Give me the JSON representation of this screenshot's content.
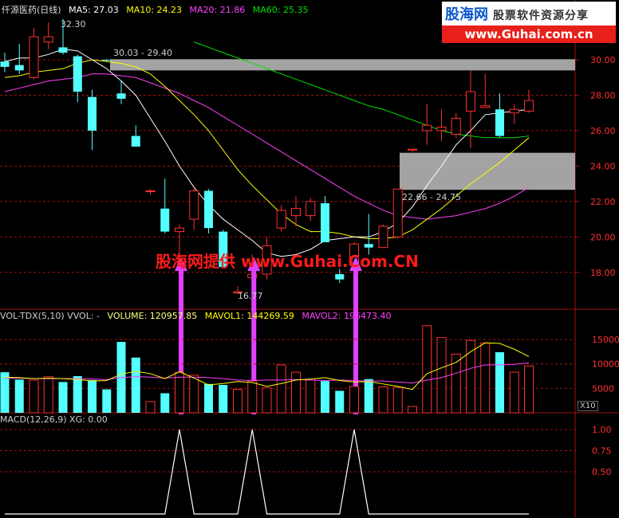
{
  "header": {
    "stock": "仟源医药(日线)",
    "ma5": "MA5: 27.03",
    "ma10": "MA10: 24.23",
    "ma20": "MA20: 21.86",
    "ma60": "MA60: 25.35"
  },
  "logo": {
    "line1": "股海网",
    "line1b": "股票软件资源分享",
    "line2": "www.Guhai.com.cn"
  },
  "watermark": "股海网提供 www.Guhai.Com.CN",
  "annotations": {
    "high_label": "32.30",
    "band_top": "30.03 - 29.40",
    "band_bottom": "22.66 - 24.75",
    "low_label": "16.77"
  },
  "volume_header": {
    "prefix": "VOL-TDX(5,10)  VVOL: -",
    "volume": "VOLUME: 120957.85",
    "mavol1": "MAVOL1: 144269.59",
    "mavol2": "MAVOL2: 196473.40"
  },
  "macd_header": "MACD(12,26,9)  XG: 0.00",
  "volume_unit": "X10",
  "colors": {
    "up": "#ff3030",
    "down": "#54ffff",
    "ma5": "#ffffff",
    "ma10": "#ffff00",
    "ma20": "#ff40ff",
    "ma60": "#00e000",
    "arrow": "#e040ff",
    "band": "#c0c0c0",
    "grid": "#a01010"
  },
  "chart_data": [
    {
      "type": "candlestick",
      "title": "仟源医药(日线)",
      "y_ticks": [
        18.0,
        20.0,
        22.0,
        24.0,
        26.0,
        28.0,
        30.0
      ],
      "ylim": [
        16.3,
        32.5
      ],
      "candles": [
        {
          "o": 29.9,
          "h": 30.4,
          "l": 29.3,
          "c": 29.6
        },
        {
          "o": 29.7,
          "h": 30.9,
          "l": 29.2,
          "c": 29.4
        },
        {
          "o": 29.0,
          "h": 31.8,
          "l": 28.9,
          "c": 31.3
        },
        {
          "o": 31.0,
          "h": 32.1,
          "l": 30.6,
          "c": 31.3
        },
        {
          "o": 30.7,
          "h": 32.3,
          "l": 30.3,
          "c": 30.4
        },
        {
          "o": 30.2,
          "h": 30.3,
          "l": 27.6,
          "c": 28.2
        },
        {
          "o": 27.9,
          "h": 28.3,
          "l": 24.9,
          "c": 26.0
        },
        {
          "o": 30.0,
          "h": 30.03,
          "l": 29.9,
          "c": 29.95
        },
        {
          "o": 28.1,
          "h": 28.8,
          "l": 27.5,
          "c": 27.8
        },
        {
          "o": 25.7,
          "h": 26.3,
          "l": 25.4,
          "c": 25.1
        },
        {
          "o": 22.6,
          "h": 22.7,
          "l": 22.4,
          "c": 22.6
        },
        {
          "o": 21.6,
          "h": 23.3,
          "l": 20.2,
          "c": 20.3
        },
        {
          "o": 20.3,
          "h": 20.7,
          "l": 18.2,
          "c": 20.5
        },
        {
          "o": 21.0,
          "h": 22.8,
          "l": 20.4,
          "c": 22.6
        },
        {
          "o": 22.6,
          "h": 22.7,
          "l": 20.2,
          "c": 20.5
        },
        {
          "o": 20.3,
          "h": 20.4,
          "l": 18.5,
          "c": 18.3
        },
        {
          "o": 16.85,
          "h": 17.2,
          "l": 16.77,
          "c": 16.9
        },
        {
          "o": 17.7,
          "h": 19.0,
          "l": 17.5,
          "c": 17.9
        },
        {
          "o": 17.9,
          "h": 20.0,
          "l": 17.6,
          "c": 19.5
        },
        {
          "o": 20.5,
          "h": 21.8,
          "l": 20.3,
          "c": 21.5
        },
        {
          "o": 21.2,
          "h": 22.3,
          "l": 20.6,
          "c": 21.6
        },
        {
          "o": 21.2,
          "h": 22.2,
          "l": 20.9,
          "c": 22.0
        },
        {
          "o": 21.9,
          "h": 22.3,
          "l": 20.2,
          "c": 19.7
        },
        {
          "o": 17.9,
          "h": 18.2,
          "l": 17.4,
          "c": 17.6
        },
        {
          "o": 18.4,
          "h": 19.7,
          "l": 18.2,
          "c": 19.6
        },
        {
          "o": 19.6,
          "h": 21.3,
          "l": 19.0,
          "c": 19.4
        },
        {
          "o": 19.4,
          "h": 20.7,
          "l": 19.4,
          "c": 20.6
        },
        {
          "o": 20.0,
          "h": 21.0,
          "l": 19.9,
          "c": 22.7
        },
        {
          "o": 24.9,
          "h": 24.95,
          "l": 24.8,
          "c": 24.95
        },
        {
          "o": 26.0,
          "h": 27.5,
          "l": 25.2,
          "c": 26.3
        },
        {
          "o": 26.0,
          "h": 27.2,
          "l": 25.4,
          "c": 26.2
        },
        {
          "o": 25.8,
          "h": 27.0,
          "l": 25.6,
          "c": 26.7
        },
        {
          "o": 27.1,
          "h": 29.4,
          "l": 25.0,
          "c": 28.2
        },
        {
          "o": 27.3,
          "h": 29.2,
          "l": 27.3,
          "c": 27.4
        },
        {
          "o": 27.2,
          "h": 28.1,
          "l": 25.6,
          "c": 25.7
        },
        {
          "o": 27.0,
          "h": 27.5,
          "l": 26.4,
          "c": 27.2
        },
        {
          "o": 27.1,
          "h": 28.3,
          "l": 27.0,
          "c": 27.7
        }
      ],
      "ma5": [
        29.9,
        30.1,
        30.1,
        30.3,
        30.6,
        30.5,
        30.0,
        29.5,
        28.8,
        28.0,
        26.7,
        25.4,
        24.0,
        22.8,
        21.8,
        21.0,
        20.4,
        19.8,
        19.1,
        18.9,
        19.0,
        19.3,
        19.8,
        19.9,
        20.0,
        20.0,
        20.3,
        20.8,
        21.7,
        22.9,
        24.0,
        25.2,
        26.0,
        26.9,
        27.0,
        27.1,
        27.2
      ],
      "ma10": [
        29.0,
        29.1,
        29.3,
        29.4,
        29.5,
        29.8,
        30.0,
        29.9,
        29.8,
        29.6,
        29.2,
        28.5,
        27.7,
        26.9,
        26.0,
        24.9,
        23.8,
        22.9,
        22.1,
        21.3,
        20.7,
        20.3,
        20.3,
        20.2,
        20.0,
        19.9,
        19.9,
        20.0,
        20.4,
        21.0,
        21.6,
        22.3,
        23.0,
        23.6,
        24.2,
        24.9,
        25.6
      ],
      "ma20": [
        28.2,
        28.4,
        28.6,
        28.8,
        28.9,
        29.0,
        29.2,
        29.2,
        29.1,
        29.0,
        28.7,
        28.4,
        28.1,
        27.7,
        27.3,
        26.8,
        26.3,
        25.8,
        25.3,
        24.8,
        24.3,
        23.8,
        23.3,
        22.8,
        22.3,
        21.9,
        21.5,
        21.2,
        21.1,
        21.0,
        21.1,
        21.2,
        21.4,
        21.6,
        21.9,
        22.3,
        22.8
      ],
      "ma60": [
        null,
        null,
        null,
        null,
        null,
        null,
        null,
        null,
        null,
        null,
        null,
        null,
        null,
        31.0,
        30.7,
        30.4,
        30.1,
        29.8,
        29.5,
        29.2,
        28.9,
        28.6,
        28.3,
        28.0,
        27.7,
        27.4,
        27.2,
        26.9,
        26.6,
        26.3,
        26.0,
        25.8,
        25.7,
        25.6,
        25.6,
        25.6,
        25.7
      ],
      "bands": [
        {
          "low": 29.4,
          "high": 30.03,
          "label": "30.03 - 29.40"
        },
        {
          "low": 22.66,
          "high": 24.75,
          "label": "22.66 - 24.75"
        }
      ],
      "signals": [
        12,
        17,
        24
      ]
    },
    {
      "type": "bar",
      "title": "VOL-TDX(5,10)",
      "unit": "X10",
      "y_ticks": [
        5000,
        10000,
        15000
      ],
      "values": [
        8300,
        6800,
        6700,
        7400,
        6300,
        7500,
        6700,
        4800,
        14500,
        11300,
        2300,
        4000,
        8300,
        7700,
        5900,
        5700,
        4800,
        6500,
        5100,
        9800,
        8300,
        6700,
        6500,
        4500,
        5400,
        6900,
        5300,
        5200,
        1300,
        17800,
        15400,
        12000,
        14800,
        14300,
        12400,
        8300,
        9600
      ],
      "mavol1": [
        7300,
        7200,
        7000,
        7100,
        7000,
        6800,
        6500,
        6600,
        7900,
        8500,
        8000,
        7000,
        8400,
        7100,
        5700,
        6000,
        6400,
        6200,
        5400,
        6000,
        6700,
        6900,
        7200,
        6600,
        6300,
        6400,
        5900,
        5400,
        4800,
        8000,
        9200,
        10300,
        12500,
        14300,
        14200,
        13000,
        11500
      ],
      "mavol2": [
        7100,
        7100,
        7000,
        7000,
        7000,
        7000,
        6900,
        6800,
        7200,
        7400,
        7300,
        7100,
        7300,
        7300,
        7200,
        7000,
        6700,
        6600,
        6700,
        6700,
        6800,
        6700,
        6600,
        6700,
        6600,
        6500,
        6500,
        6300,
        6100,
        6700,
        7200,
        8100,
        9100,
        9800,
        9800,
        9900,
        10200
      ]
    },
    {
      "type": "line",
      "title": "MACD(12,26,9)",
      "y_ticks": [
        0.5,
        0.75,
        1.0
      ],
      "xg": [
        0,
        0,
        0,
        0,
        0,
        0,
        0,
        0,
        0,
        0,
        0,
        0,
        1,
        0,
        0,
        0,
        0,
        1,
        0,
        0,
        0,
        0,
        0,
        0,
        1,
        0,
        0,
        0,
        0,
        0,
        0,
        0,
        0,
        0,
        0,
        0,
        0
      ]
    }
  ]
}
